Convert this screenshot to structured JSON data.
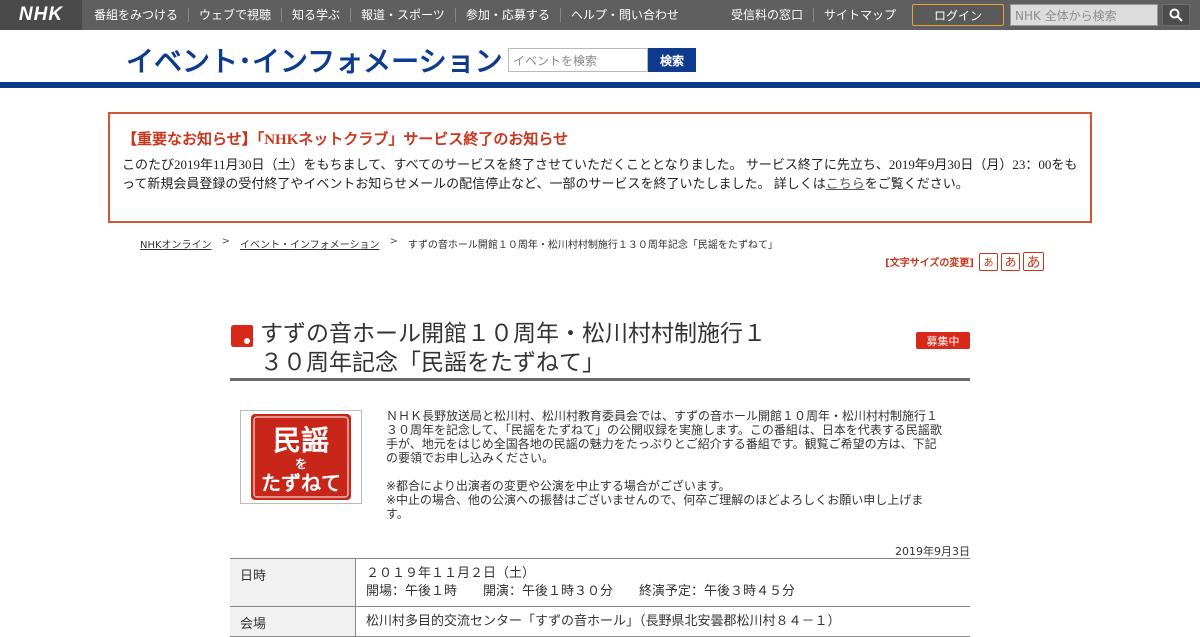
{
  "global_nav": {
    "logo": "NHK",
    "items": [
      "番組をみつける",
      "ウェブで視聴",
      "知る学ぶ",
      "報道・スポーツ",
      "参加・応募する",
      "ヘルプ・問い合わせ"
    ],
    "right_items": [
      "受信料の窓口",
      "サイトマップ"
    ],
    "login_label": "ログイン",
    "search_placeholder": "NHK 全体から検索",
    "search_icon": "search-icon"
  },
  "site_header": {
    "title": "イベント･インフォメーション",
    "search_placeholder": "イベントを検索",
    "search_button": "検索"
  },
  "notice": {
    "title": "【重要なお知らせ】「NHKネットクラブ」サービス終了のお知らせ",
    "body_before_link": "このたび2019年11月30日（土）をもちまして、すべてのサービスを終了させていただくこととなりました。 サービス終了に先立ち、2019年9月30日（月）23：00をもって新規会員登録の受付終了やイベントお知らせメールの配信停止など、一部のサービスを終了いたしました。 詳しくは",
    "link_text": "こちら",
    "body_after_link": "をご覧ください。"
  },
  "breadcrumb": {
    "items": [
      "NHKオンライン",
      "イベント・インフォメーション",
      "すずの音ホール開館１０周年・松川村村制施行１３０周年記念「民謡をたずねて」"
    ],
    "separator": ">"
  },
  "font_size": {
    "label": "[文字サイズの変更]",
    "small": "あ",
    "medium": "あ",
    "large": "あ"
  },
  "event": {
    "title_line1": "すずの音ホール開館１０周年・松川村村制施行１",
    "title_line2": "３０周年記念「民謡をたずねて」",
    "status": "募集中",
    "thumbnail_text": {
      "top": "民謡",
      "middle": "を",
      "bottom": "たずねて"
    },
    "description": [
      "ＮＨＫ長野放送局と松川村、松川村教育委員会では、すずの音ホール開館１０周年・松川村村制施行１３０周年を記念して、「民謡をたずねて」の公開収録を実施します。この番組は、日本を代表する民謡歌手が、地元をはじめ全国各地の民謡の魅力をたっぷりとご紹介する番組です。観覧ご希望の方は、下記の要領でお申し込みください。",
      "※都合により出演者の変更や公演を中止する場合がございます。\n※中止の場合、他の公演への振替はございませんので、何卒ご理解のほどよろしくお願い申し上げます。"
    ],
    "posted_date": "2019年9月3日",
    "details": [
      {
        "label": "日時",
        "value_line1": "２０１９年１１月２日（土）",
        "value_line2": "開場：午後１時　　開演：午後１時３０分　　終演予定：午後３時４５分"
      },
      {
        "label": "会場",
        "value_line1": "松川村多目的交流センター「すずの音ホール」（長野県北安曇郡松川村８４－１）",
        "value_line2": ""
      }
    ]
  },
  "colors": {
    "global_nav_bg": "#5f5f5f",
    "brand_blue": "#0b3b8f",
    "notice_red": "#c8371d",
    "badge_red": "#d72819",
    "login_border": "#e7a33a"
  }
}
